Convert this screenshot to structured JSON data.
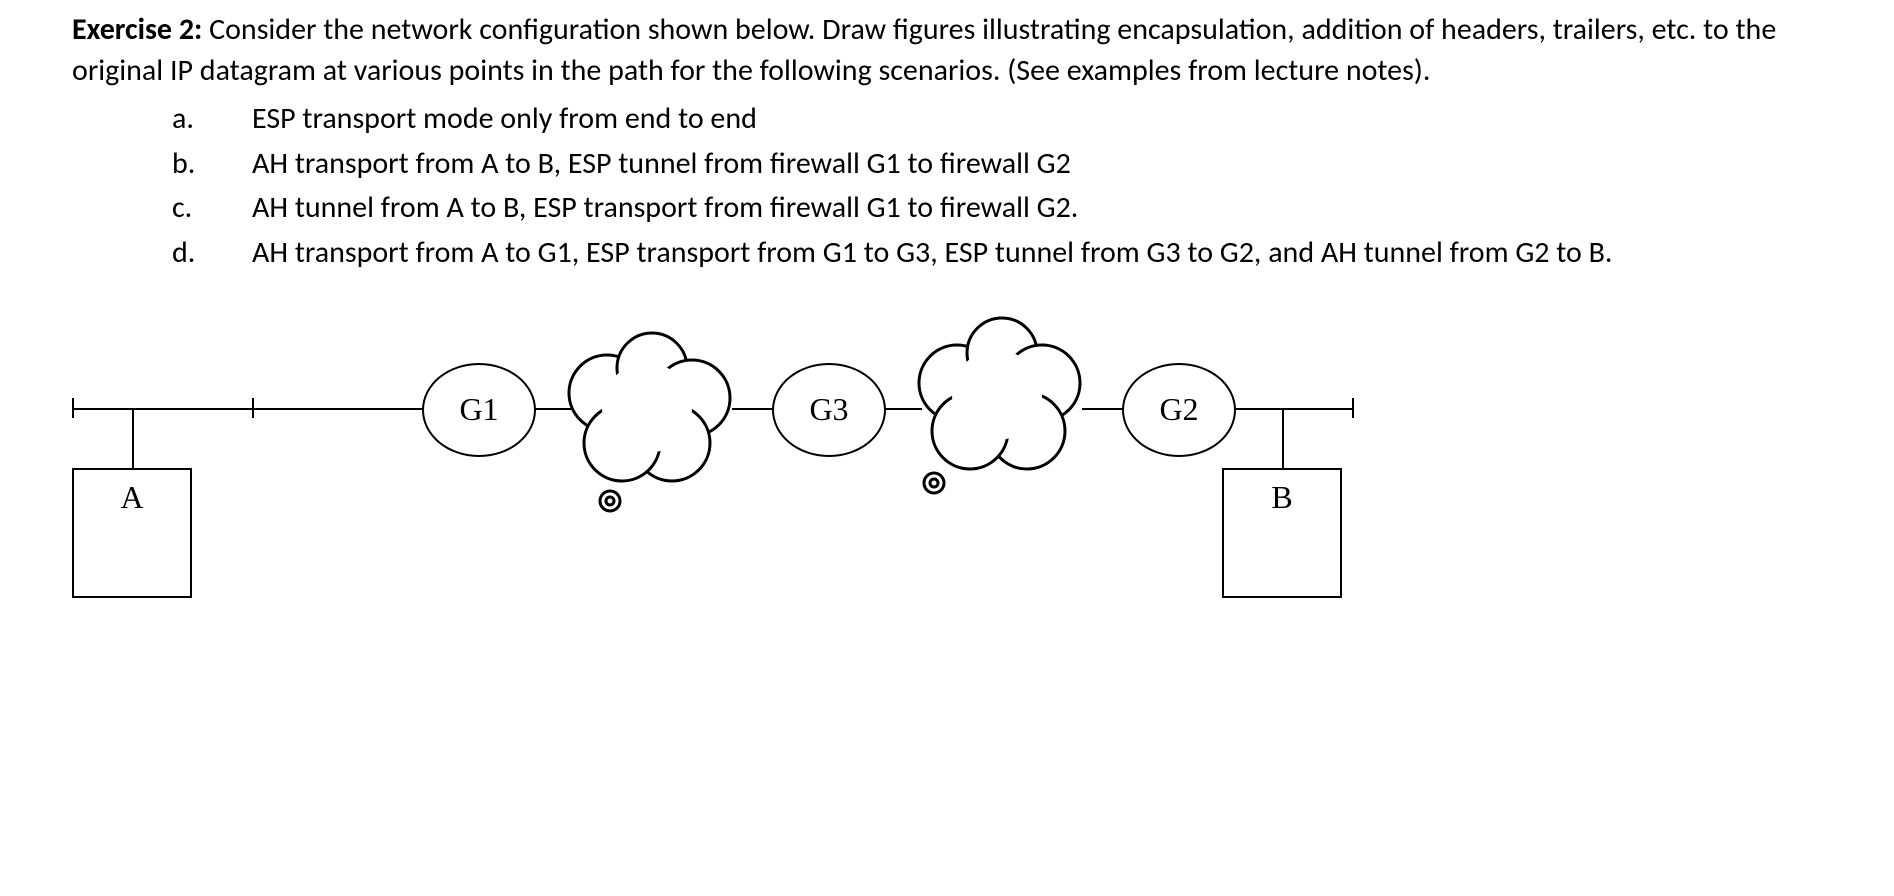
{
  "exercise": {
    "label": "Exercise 2:",
    "intro": "Consider the network configuration shown below. Draw figures illustrating encapsulation, addition of headers, trailers, etc. to the original IP datagram at various points in the path for the following scenarios. (See examples from lecture notes).",
    "items": [
      {
        "marker": "a.",
        "text": "ESP transport mode only from end to end"
      },
      {
        "marker": "b.",
        "text": "AH transport from A to B, ESP tunnel from firewall G1 to firewall G2"
      },
      {
        "marker": "c.",
        "text": "AH tunnel from A to B, ESP transport from firewall G1 to firewall G2."
      },
      {
        "marker": "d.",
        "text": "AH transport from A to G1, ESP transport from G1 to G3, ESP tunnel from G3 to G2, and AH tunnel from G2 to B."
      }
    ]
  },
  "diagram": {
    "nodes": {
      "A": "A",
      "B": "B",
      "G1": "G1",
      "G2": "G2",
      "G3": "G3"
    }
  }
}
